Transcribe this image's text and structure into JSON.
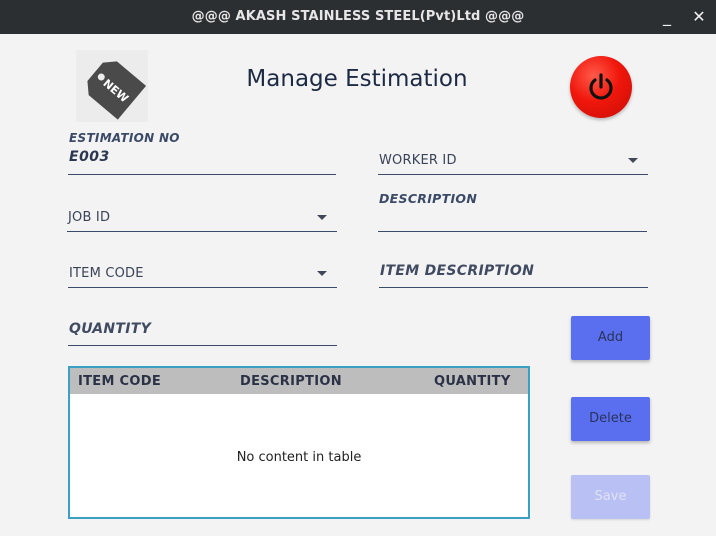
{
  "window": {
    "title": "@@@ AKASH STAINLESS STEEL(Pvt)Ltd @@@",
    "minimize_glyph": "_",
    "close_glyph": "✕"
  },
  "header": {
    "title": "Manage Estimation",
    "logo_text": "NEW",
    "logo_icon": "new-tag-icon",
    "power_icon": "power-icon",
    "power_color": "#f0170c"
  },
  "form": {
    "estimation_no": {
      "label": "ESTIMATION NO",
      "value": "E003"
    },
    "worker_id": {
      "prompt": "WORKER ID"
    },
    "description": {
      "label": "DESCRIPTION",
      "value": ""
    },
    "job_id": {
      "prompt": "JOB ID"
    },
    "item_code": {
      "prompt": "ITEM CODE"
    },
    "item_description": {
      "prompt": "ITEM DESCRIPTION"
    },
    "quantity": {
      "prompt": "QUANTITY"
    }
  },
  "table": {
    "columns": [
      "ITEM CODE",
      "DESCRIPTION",
      "QUANTITY"
    ],
    "rows": [],
    "placeholder": "No content in table"
  },
  "buttons": {
    "add": "Add",
    "delete": "Delete",
    "save": "Save",
    "accent": "#5a6ff0",
    "disabled": "#b9c0f3"
  }
}
